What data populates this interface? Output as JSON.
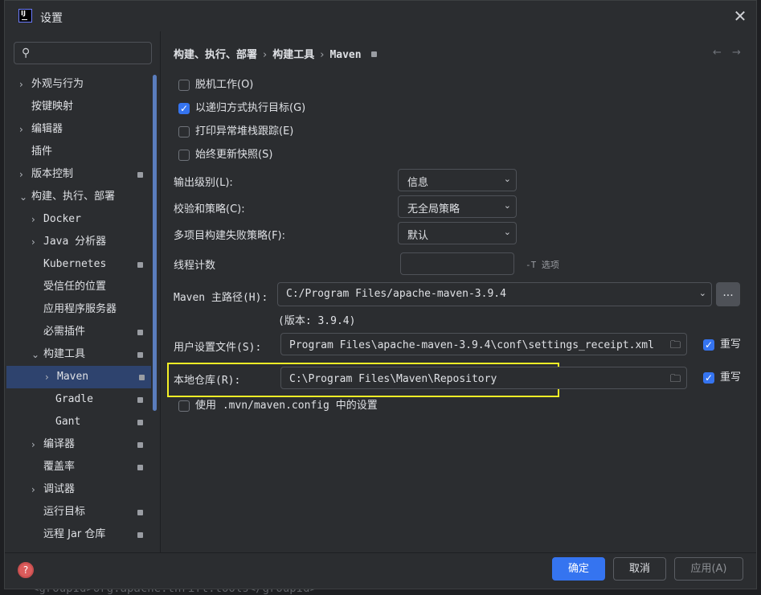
{
  "window": {
    "title": "设置"
  },
  "sidebar": {
    "search_placeholder": "",
    "items": [
      {
        "label": "外观与行为",
        "arrow": "›",
        "badge": false
      },
      {
        "label": "按键映射",
        "arrow": "",
        "badge": false
      },
      {
        "label": "编辑器",
        "arrow": "›",
        "badge": false
      },
      {
        "label": "插件",
        "arrow": "",
        "badge": false
      },
      {
        "label": "版本控制",
        "arrow": "›",
        "badge": true
      },
      {
        "label": "构建、执行、部署",
        "arrow": "⌄",
        "badge": false
      },
      {
        "label": "Docker",
        "arrow": "›",
        "badge": false
      },
      {
        "label": "Java 分析器",
        "arrow": "›",
        "badge": false
      },
      {
        "label": "Kubernetes",
        "arrow": "",
        "badge": true
      },
      {
        "label": "受信任的位置",
        "arrow": "",
        "badge": false
      },
      {
        "label": "应用程序服务器",
        "arrow": "",
        "badge": false
      },
      {
        "label": "必需插件",
        "arrow": "",
        "badge": true
      },
      {
        "label": "构建工具",
        "arrow": "⌄",
        "badge": true
      },
      {
        "label": "Maven",
        "arrow": "›",
        "badge": true,
        "selected": true
      },
      {
        "label": "Gradle",
        "arrow": "",
        "badge": true
      },
      {
        "label": "Gant",
        "arrow": "",
        "badge": true
      },
      {
        "label": "编译器",
        "arrow": "›",
        "badge": true
      },
      {
        "label": "覆盖率",
        "arrow": "",
        "badge": true
      },
      {
        "label": "调试器",
        "arrow": "›",
        "badge": false
      },
      {
        "label": "运行目标",
        "arrow": "",
        "badge": true
      },
      {
        "label": "远程 Jar 仓库",
        "arrow": "",
        "badge": true
      }
    ]
  },
  "breadcrumb": {
    "items": [
      "构建、执行、部署",
      "构建工具",
      "Maven"
    ],
    "sep": "›"
  },
  "nav": {
    "back": "←",
    "forward": "→"
  },
  "options": {
    "offline": {
      "label": "脱机工作(O)",
      "checked": false
    },
    "recursive": {
      "label": "以递归方式执行目标(G)",
      "checked": true
    },
    "stacktrace": {
      "label": "打印异常堆栈跟踪(E)",
      "checked": false
    },
    "snapshots": {
      "label": "始终更新快照(S)",
      "checked": false
    }
  },
  "output_level": {
    "label": "输出级别(L):",
    "value": "信息"
  },
  "checksum_policy": {
    "label": "校验和策略(C):",
    "value": "无全局策略"
  },
  "failure_policy": {
    "label": "多项目构建失败策略(F):",
    "value": "默认"
  },
  "thread_count": {
    "label": "线程计数",
    "value": "",
    "hint": "-T 选项"
  },
  "maven_home": {
    "label": "Maven 主路径(H):",
    "value": "C:/Program Files/apache-maven-3.9.4",
    "version": "(版本: 3.9.4)",
    "browse": "..."
  },
  "user_settings": {
    "label": "用户设置文件(S):",
    "value": "Program Files\\apache-maven-3.9.4\\conf\\settings_receipt.xml",
    "override_label": "重写",
    "override": true
  },
  "local_repo": {
    "label": "本地仓库(R):",
    "value": "C:\\Program Files\\Maven\\Repository",
    "override_label": "重写",
    "override": true
  },
  "mvn_config": {
    "label": "使用 .mvn/maven.config 中的设置",
    "checked": false
  },
  "buttons": {
    "ok": "确定",
    "cancel": "取消",
    "apply": "应用(A)"
  },
  "background_code": {
    "text": "<groupId>org.apache.thrift.tools</groupId>"
  },
  "colors": {
    "accent": "#3574f0",
    "highlight": "#f4f026",
    "selected_row": "#2e436e"
  }
}
